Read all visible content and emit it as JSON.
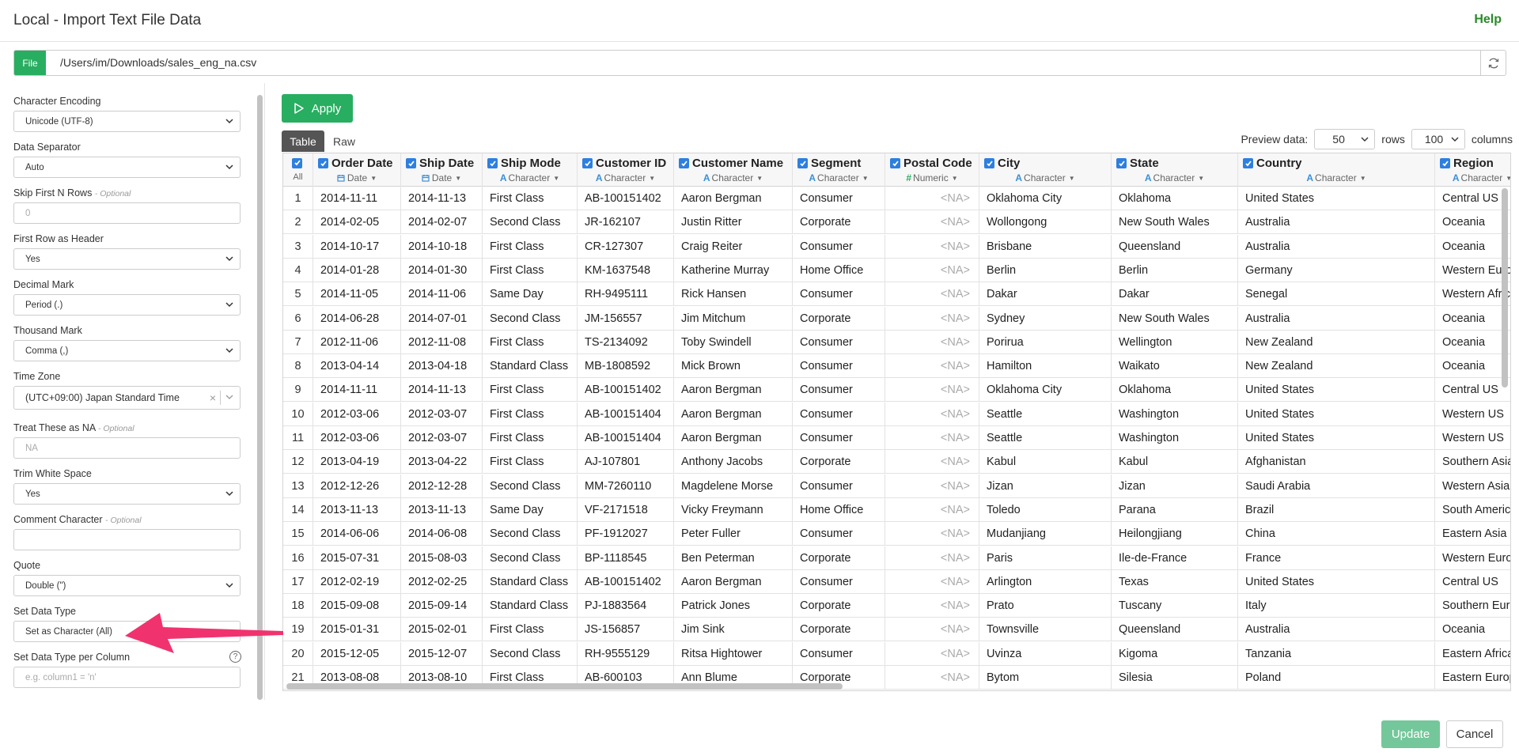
{
  "window": {
    "title": "Local - Import Text File Data",
    "help_label": "Help"
  },
  "file": {
    "button_label": "File",
    "path": "/Users/im/Downloads/sales_eng_na.csv",
    "refresh_icon": "refresh-icon"
  },
  "settings": {
    "character_encoding": {
      "label": "Character Encoding",
      "value": "Unicode (UTF-8)"
    },
    "data_separator": {
      "label": "Data Separator",
      "value": "Auto"
    },
    "skip_first_rows": {
      "label": "Skip First N Rows",
      "optional": "- Optional",
      "placeholder": "0"
    },
    "first_row_header": {
      "label": "First Row as Header",
      "value": "Yes"
    },
    "decimal_mark": {
      "label": "Decimal Mark",
      "value": "Period (.)"
    },
    "thousand_mark": {
      "label": "Thousand Mark",
      "value": "Comma (,)"
    },
    "time_zone": {
      "label": "Time Zone",
      "value": "(UTC+09:00) Japan Standard Time"
    },
    "treat_as_na": {
      "label": "Treat These as NA",
      "optional": "- Optional",
      "placeholder": "NA"
    },
    "trim_white_space": {
      "label": "Trim White Space",
      "value": "Yes"
    },
    "comment_character": {
      "label": "Comment Character",
      "optional": "- Optional",
      "value": ""
    },
    "quote": {
      "label": "Quote",
      "value": "Double (\")"
    },
    "set_data_type": {
      "label": "Set Data Type",
      "value": "Set as Character (All)"
    },
    "set_data_type_per_column": {
      "label": "Set Data Type per Column",
      "placeholder": "e.g. column1 = 'n'"
    }
  },
  "toolbar": {
    "apply_label": "Apply",
    "tab_table": "Table",
    "tab_raw": "Raw",
    "preview_label": "Preview data:",
    "preview_rows": "50",
    "rows_label": "rows",
    "preview_columns": "100",
    "columns_label": "columns"
  },
  "table": {
    "all_label": "All",
    "columns": [
      {
        "name": "Order Date",
        "type": "Date",
        "icon": "calendar-icon"
      },
      {
        "name": "Ship Date",
        "type": "Date",
        "icon": "calendar-icon"
      },
      {
        "name": "Ship Mode",
        "type": "Character",
        "icon": "character-type-icon"
      },
      {
        "name": "Customer ID",
        "type": "Character",
        "icon": "character-type-icon"
      },
      {
        "name": "Customer Name",
        "type": "Character",
        "icon": "character-type-icon"
      },
      {
        "name": "Segment",
        "type": "Character",
        "icon": "character-type-icon"
      },
      {
        "name": "Postal Code",
        "type": "Numeric",
        "icon": "numeric-type-icon"
      },
      {
        "name": "City",
        "type": "Character",
        "icon": "character-type-icon"
      },
      {
        "name": "State",
        "type": "Character",
        "icon": "character-type-icon"
      },
      {
        "name": "Country",
        "type": "Character",
        "icon": "character-type-icon"
      },
      {
        "name": "Region",
        "type": "Character",
        "icon": "character-type-icon"
      }
    ],
    "rows": [
      [
        "1",
        "2014-11-11",
        "2014-11-13",
        "First Class",
        "AB-100151402",
        "Aaron Bergman",
        "Consumer",
        "<NA>",
        "Oklahoma City",
        "Oklahoma",
        "United States",
        "Central US"
      ],
      [
        "2",
        "2014-02-05",
        "2014-02-07",
        "Second Class",
        "JR-162107",
        "Justin Ritter",
        "Corporate",
        "<NA>",
        "Wollongong",
        "New South Wales",
        "Australia",
        "Oceania"
      ],
      [
        "3",
        "2014-10-17",
        "2014-10-18",
        "First Class",
        "CR-127307",
        "Craig Reiter",
        "Consumer",
        "<NA>",
        "Brisbane",
        "Queensland",
        "Australia",
        "Oceania"
      ],
      [
        "4",
        "2014-01-28",
        "2014-01-30",
        "First Class",
        "KM-1637548",
        "Katherine Murray",
        "Home Office",
        "<NA>",
        "Berlin",
        "Berlin",
        "Germany",
        "Western Europe"
      ],
      [
        "5",
        "2014-11-05",
        "2014-11-06",
        "Same Day",
        "RH-9495111",
        "Rick Hansen",
        "Consumer",
        "<NA>",
        "Dakar",
        "Dakar",
        "Senegal",
        "Western Africa"
      ],
      [
        "6",
        "2014-06-28",
        "2014-07-01",
        "Second Class",
        "JM-156557",
        "Jim Mitchum",
        "Corporate",
        "<NA>",
        "Sydney",
        "New South Wales",
        "Australia",
        "Oceania"
      ],
      [
        "7",
        "2012-11-06",
        "2012-11-08",
        "First Class",
        "TS-2134092",
        "Toby Swindell",
        "Consumer",
        "<NA>",
        "Porirua",
        "Wellington",
        "New Zealand",
        "Oceania"
      ],
      [
        "8",
        "2013-04-14",
        "2013-04-18",
        "Standard Class",
        "MB-1808592",
        "Mick Brown",
        "Consumer",
        "<NA>",
        "Hamilton",
        "Waikato",
        "New Zealand",
        "Oceania"
      ],
      [
        "9",
        "2014-11-11",
        "2014-11-13",
        "First Class",
        "AB-100151402",
        "Aaron Bergman",
        "Consumer",
        "<NA>",
        "Oklahoma City",
        "Oklahoma",
        "United States",
        "Central US"
      ],
      [
        "10",
        "2012-03-06",
        "2012-03-07",
        "First Class",
        "AB-100151404",
        "Aaron Bergman",
        "Consumer",
        "<NA>",
        "Seattle",
        "Washington",
        "United States",
        "Western US"
      ],
      [
        "11",
        "2012-03-06",
        "2012-03-07",
        "First Class",
        "AB-100151404",
        "Aaron Bergman",
        "Consumer",
        "<NA>",
        "Seattle",
        "Washington",
        "United States",
        "Western US"
      ],
      [
        "12",
        "2013-04-19",
        "2013-04-22",
        "First Class",
        "AJ-107801",
        "Anthony Jacobs",
        "Corporate",
        "<NA>",
        "Kabul",
        "Kabul",
        "Afghanistan",
        "Southern Asia"
      ],
      [
        "13",
        "2012-12-26",
        "2012-12-28",
        "Second Class",
        "MM-7260110",
        "Magdelene Morse",
        "Consumer",
        "<NA>",
        "Jizan",
        "Jizan",
        "Saudi Arabia",
        "Western Asia"
      ],
      [
        "14",
        "2013-11-13",
        "2013-11-13",
        "Same Day",
        "VF-2171518",
        "Vicky Freymann",
        "Home Office",
        "<NA>",
        "Toledo",
        "Parana",
        "Brazil",
        "South America"
      ],
      [
        "15",
        "2014-06-06",
        "2014-06-08",
        "Second Class",
        "PF-1912027",
        "Peter Fuller",
        "Consumer",
        "<NA>",
        "Mudanjiang",
        "Heilongjiang",
        "China",
        "Eastern Asia"
      ],
      [
        "16",
        "2015-07-31",
        "2015-08-03",
        "Second Class",
        "BP-1118545",
        "Ben Peterman",
        "Corporate",
        "<NA>",
        "Paris",
        "Ile-de-France",
        "France",
        "Western Europe"
      ],
      [
        "17",
        "2012-02-19",
        "2012-02-25",
        "Standard Class",
        "AB-100151402",
        "Aaron Bergman",
        "Consumer",
        "<NA>",
        "Arlington",
        "Texas",
        "United States",
        "Central US"
      ],
      [
        "18",
        "2015-09-08",
        "2015-09-14",
        "Standard Class",
        "PJ-1883564",
        "Patrick Jones",
        "Corporate",
        "<NA>",
        "Prato",
        "Tuscany",
        "Italy",
        "Southern Europe"
      ],
      [
        "19",
        "2015-01-31",
        "2015-02-01",
        "First Class",
        "JS-156857",
        "Jim Sink",
        "Corporate",
        "<NA>",
        "Townsville",
        "Queensland",
        "Australia",
        "Oceania"
      ],
      [
        "20",
        "2015-12-05",
        "2015-12-07",
        "Second Class",
        "RH-9555129",
        "Ritsa Hightower",
        "Consumer",
        "<NA>",
        "Uvinza",
        "Kigoma",
        "Tanzania",
        "Eastern Africa"
      ],
      [
        "21",
        "2013-08-08",
        "2013-08-10",
        "First Class",
        "AB-600103",
        "Ann Blume",
        "Corporate",
        "<NA>",
        "Bytom",
        "Silesia",
        "Poland",
        "Eastern Europe"
      ]
    ]
  },
  "footer": {
    "update_label": "Update",
    "cancel_label": "Cancel"
  },
  "colors": {
    "accent_green": "#27ae60",
    "checkbox_blue": "#2d7fe0",
    "annotation_arrow": "#f0336e"
  }
}
